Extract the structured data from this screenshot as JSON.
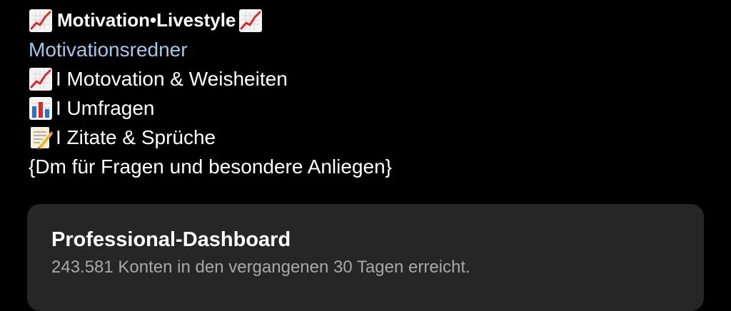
{
  "profile": {
    "title": "Motivation•Livestyle",
    "category": "Motivationsredner",
    "bio_lines": [
      "I Motovation & Weisheiten",
      "I Umfragen",
      "I Zitate & Sprüche",
      "{Dm für Fragen und besondere Anliegen}"
    ],
    "icons": {
      "title_leading": "chart-increasing-icon",
      "title_trailing": "chart-increasing-icon",
      "line1": "chart-increasing-icon",
      "line2": "bar-chart-icon",
      "line3": "memo-icon"
    }
  },
  "dashboard": {
    "title": "Professional-Dashboard",
    "subtitle": "243.581 Konten in den vergangenen 30 Tagen erreicht."
  },
  "colors": {
    "background": "#000000",
    "category_link": "#a7c7e7",
    "card": "#262626",
    "subtitle": "#a8a8a8"
  }
}
